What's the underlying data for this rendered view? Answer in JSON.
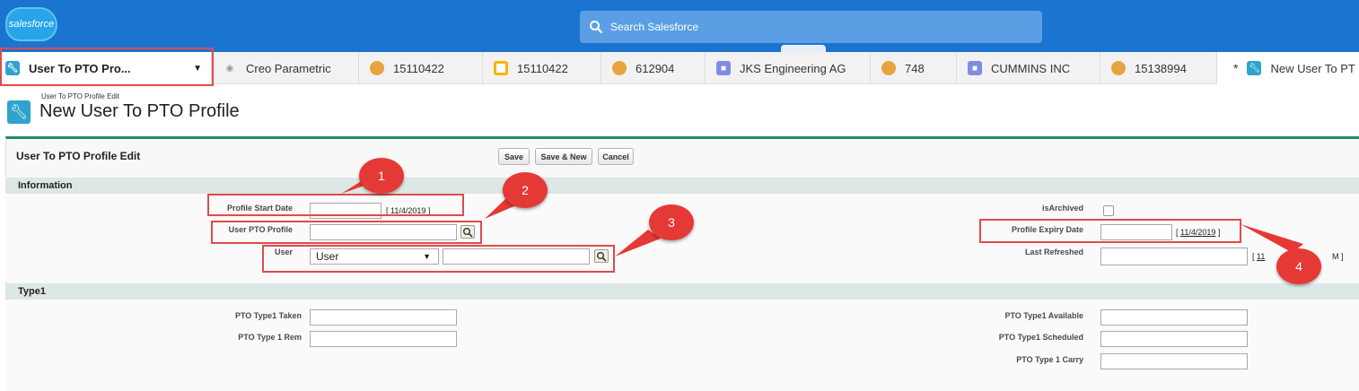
{
  "header": {
    "logo_text": "salesforce",
    "search_placeholder": "Search Salesforce",
    "brand_color": "#1b74d0"
  },
  "tabs": [
    {
      "label": "User To PTO Pro...",
      "icon": "wrench-icon",
      "color": "#2fa3cc"
    },
    {
      "label": "Creo Parametric",
      "icon": "product-icon",
      "color": "#9e9e9e"
    },
    {
      "label": "15110422",
      "icon": "case-icon",
      "color": "#e5a43d"
    },
    {
      "label": "15110422",
      "icon": "task-icon",
      "color": "#f4b400"
    },
    {
      "label": "612904",
      "icon": "case-icon",
      "color": "#e5a43d"
    },
    {
      "label": "JKS Engineering AG",
      "icon": "account-icon",
      "color": "#7f8de1"
    },
    {
      "label": "748",
      "icon": "case-icon",
      "color": "#e5a43d"
    },
    {
      "label": "CUMMINS INC",
      "icon": "account-icon",
      "color": "#7f8de1"
    },
    {
      "label": "15138994",
      "icon": "case-icon",
      "color": "#e5a43d"
    },
    {
      "label": "New User To PT",
      "icon": "wrench-icon",
      "color": "#2fa3cc",
      "star": "*"
    }
  ],
  "page": {
    "breadcrumb": "User To PTO Profile Edit",
    "title": "New User To PTO Profile"
  },
  "form": {
    "panel_title": "User To PTO Profile Edit",
    "buttons": {
      "save": "Save",
      "save_new": "Save & New",
      "cancel": "Cancel"
    },
    "sections": {
      "information": "Information",
      "type1": "Type1"
    },
    "fields": {
      "profile_start_date": {
        "label": "Profile Start Date",
        "value": "",
        "date_link": "11/4/2019"
      },
      "user_pto_profile": {
        "label": "User PTO Profile",
        "value": ""
      },
      "user": {
        "label": "User",
        "select_value": "User",
        "value": ""
      },
      "is_archived": {
        "label": "isArchived",
        "checked": false
      },
      "profile_expiry_date": {
        "label": "Profile Expiry Date",
        "value": "",
        "date_link": "11/4/2019"
      },
      "last_refreshed": {
        "label": "Last Refreshed",
        "value": "",
        "link_partial": "11",
        "link_tail": "M ]"
      },
      "pto_type1_taken": {
        "label": "PTO Type1 Taken",
        "value": ""
      },
      "pto_type1_rem": {
        "label": "PTO Type 1 Rem",
        "value": ""
      },
      "pto_type1_available": {
        "label": "PTO Type1 Available",
        "value": ""
      },
      "pto_type1_scheduled": {
        "label": "PTO Type1 Scheduled",
        "value": ""
      },
      "pto_type1_carry": {
        "label": "PTO Type 1 Carry",
        "value": ""
      }
    }
  },
  "callouts": [
    "1",
    "2",
    "3",
    "4"
  ],
  "colors": {
    "callout": "#e53935",
    "section": "#dde7e5",
    "panel_accent": "#1f8a6e"
  }
}
